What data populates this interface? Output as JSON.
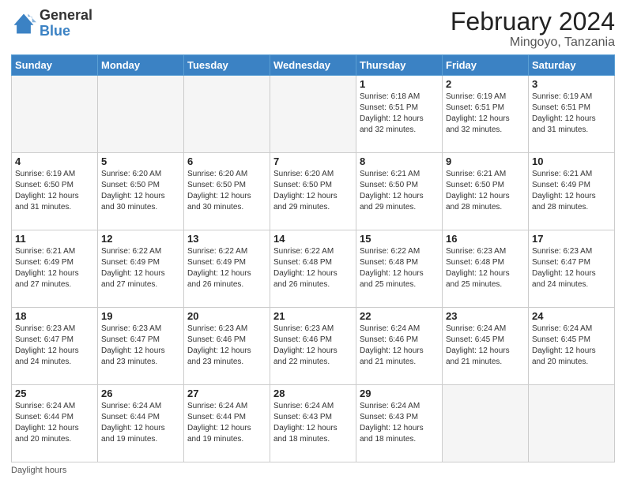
{
  "logo": {
    "general": "General",
    "blue": "Blue"
  },
  "header": {
    "title": "February 2024",
    "subtitle": "Mingoyo, Tanzania"
  },
  "weekdays": [
    "Sunday",
    "Monday",
    "Tuesday",
    "Wednesday",
    "Thursday",
    "Friday",
    "Saturday"
  ],
  "weeks": [
    [
      {
        "day": "",
        "info": ""
      },
      {
        "day": "",
        "info": ""
      },
      {
        "day": "",
        "info": ""
      },
      {
        "day": "",
        "info": ""
      },
      {
        "day": "1",
        "info": "Sunrise: 6:18 AM\nSunset: 6:51 PM\nDaylight: 12 hours\nand 32 minutes."
      },
      {
        "day": "2",
        "info": "Sunrise: 6:19 AM\nSunset: 6:51 PM\nDaylight: 12 hours\nand 32 minutes."
      },
      {
        "day": "3",
        "info": "Sunrise: 6:19 AM\nSunset: 6:51 PM\nDaylight: 12 hours\nand 31 minutes."
      }
    ],
    [
      {
        "day": "4",
        "info": "Sunrise: 6:19 AM\nSunset: 6:50 PM\nDaylight: 12 hours\nand 31 minutes."
      },
      {
        "day": "5",
        "info": "Sunrise: 6:20 AM\nSunset: 6:50 PM\nDaylight: 12 hours\nand 30 minutes."
      },
      {
        "day": "6",
        "info": "Sunrise: 6:20 AM\nSunset: 6:50 PM\nDaylight: 12 hours\nand 30 minutes."
      },
      {
        "day": "7",
        "info": "Sunrise: 6:20 AM\nSunset: 6:50 PM\nDaylight: 12 hours\nand 29 minutes."
      },
      {
        "day": "8",
        "info": "Sunrise: 6:21 AM\nSunset: 6:50 PM\nDaylight: 12 hours\nand 29 minutes."
      },
      {
        "day": "9",
        "info": "Sunrise: 6:21 AM\nSunset: 6:50 PM\nDaylight: 12 hours\nand 28 minutes."
      },
      {
        "day": "10",
        "info": "Sunrise: 6:21 AM\nSunset: 6:49 PM\nDaylight: 12 hours\nand 28 minutes."
      }
    ],
    [
      {
        "day": "11",
        "info": "Sunrise: 6:21 AM\nSunset: 6:49 PM\nDaylight: 12 hours\nand 27 minutes."
      },
      {
        "day": "12",
        "info": "Sunrise: 6:22 AM\nSunset: 6:49 PM\nDaylight: 12 hours\nand 27 minutes."
      },
      {
        "day": "13",
        "info": "Sunrise: 6:22 AM\nSunset: 6:49 PM\nDaylight: 12 hours\nand 26 minutes."
      },
      {
        "day": "14",
        "info": "Sunrise: 6:22 AM\nSunset: 6:48 PM\nDaylight: 12 hours\nand 26 minutes."
      },
      {
        "day": "15",
        "info": "Sunrise: 6:22 AM\nSunset: 6:48 PM\nDaylight: 12 hours\nand 25 minutes."
      },
      {
        "day": "16",
        "info": "Sunrise: 6:23 AM\nSunset: 6:48 PM\nDaylight: 12 hours\nand 25 minutes."
      },
      {
        "day": "17",
        "info": "Sunrise: 6:23 AM\nSunset: 6:47 PM\nDaylight: 12 hours\nand 24 minutes."
      }
    ],
    [
      {
        "day": "18",
        "info": "Sunrise: 6:23 AM\nSunset: 6:47 PM\nDaylight: 12 hours\nand 24 minutes."
      },
      {
        "day": "19",
        "info": "Sunrise: 6:23 AM\nSunset: 6:47 PM\nDaylight: 12 hours\nand 23 minutes."
      },
      {
        "day": "20",
        "info": "Sunrise: 6:23 AM\nSunset: 6:46 PM\nDaylight: 12 hours\nand 23 minutes."
      },
      {
        "day": "21",
        "info": "Sunrise: 6:23 AM\nSunset: 6:46 PM\nDaylight: 12 hours\nand 22 minutes."
      },
      {
        "day": "22",
        "info": "Sunrise: 6:24 AM\nSunset: 6:46 PM\nDaylight: 12 hours\nand 21 minutes."
      },
      {
        "day": "23",
        "info": "Sunrise: 6:24 AM\nSunset: 6:45 PM\nDaylight: 12 hours\nand 21 minutes."
      },
      {
        "day": "24",
        "info": "Sunrise: 6:24 AM\nSunset: 6:45 PM\nDaylight: 12 hours\nand 20 minutes."
      }
    ],
    [
      {
        "day": "25",
        "info": "Sunrise: 6:24 AM\nSunset: 6:44 PM\nDaylight: 12 hours\nand 20 minutes."
      },
      {
        "day": "26",
        "info": "Sunrise: 6:24 AM\nSunset: 6:44 PM\nDaylight: 12 hours\nand 19 minutes."
      },
      {
        "day": "27",
        "info": "Sunrise: 6:24 AM\nSunset: 6:44 PM\nDaylight: 12 hours\nand 19 minutes."
      },
      {
        "day": "28",
        "info": "Sunrise: 6:24 AM\nSunset: 6:43 PM\nDaylight: 12 hours\nand 18 minutes."
      },
      {
        "day": "29",
        "info": "Sunrise: 6:24 AM\nSunset: 6:43 PM\nDaylight: 12 hours\nand 18 minutes."
      },
      {
        "day": "",
        "info": ""
      },
      {
        "day": "",
        "info": ""
      }
    ]
  ],
  "footer": {
    "text": "Daylight hours"
  },
  "colors": {
    "header_bg": "#3b82c4",
    "accent": "#3b82c4"
  }
}
